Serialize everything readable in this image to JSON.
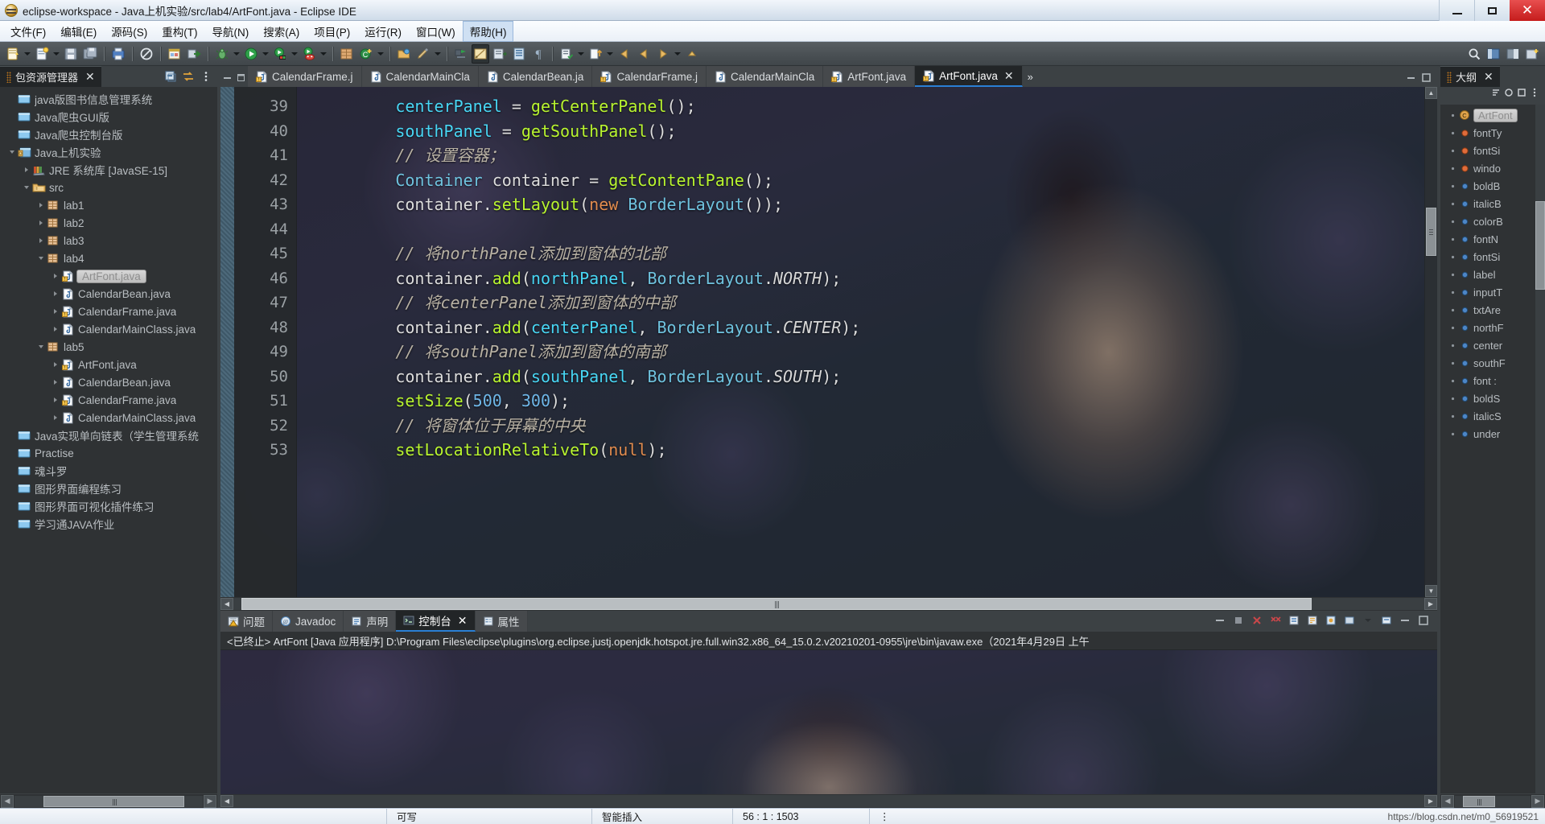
{
  "window": {
    "title": "eclipse-workspace - Java上机实验/src/lab4/ArtFont.java - Eclipse IDE",
    "app_icon": "eclipse-icon",
    "minimize_label": "最小化",
    "maximize_label": "最大化",
    "close_label": "关闭"
  },
  "menubar": {
    "items": [
      {
        "label": "文件(F)",
        "name": "menu-file"
      },
      {
        "label": "编辑(E)",
        "name": "menu-edit"
      },
      {
        "label": "源码(S)",
        "name": "menu-source"
      },
      {
        "label": "重构(T)",
        "name": "menu-refactor"
      },
      {
        "label": "导航(N)",
        "name": "menu-navigate"
      },
      {
        "label": "搜索(A)",
        "name": "menu-search"
      },
      {
        "label": "项目(P)",
        "name": "menu-project"
      },
      {
        "label": "运行(R)",
        "name": "menu-run"
      },
      {
        "label": "窗口(W)",
        "name": "menu-window"
      },
      {
        "label": "帮助(H)",
        "name": "menu-help"
      }
    ],
    "active_index": 9
  },
  "explorer": {
    "tab_title": "包资源管理器",
    "tab_close": "✕",
    "tree": [
      {
        "label": "java版图书信息管理系统",
        "depth": 0,
        "icon": "closed-project-folder-icon",
        "arrow": "none",
        "selected": false
      },
      {
        "label": "Java爬虫GUI版",
        "depth": 0,
        "icon": "closed-project-folder-icon",
        "arrow": "none",
        "selected": false
      },
      {
        "label": "Java爬虫控制台版",
        "depth": 0,
        "icon": "closed-project-folder-icon",
        "arrow": "none",
        "selected": false
      },
      {
        "label": "Java上机实验",
        "depth": 0,
        "icon": "java-project-icon",
        "arrow": "open",
        "selected": false
      },
      {
        "label": "JRE 系统库 [JavaSE-15]",
        "depth": 1,
        "icon": "jre-library-icon",
        "arrow": "closed",
        "selected": false
      },
      {
        "label": "src",
        "depth": 1,
        "icon": "source-folder-icon",
        "arrow": "open",
        "selected": false
      },
      {
        "label": "lab1",
        "depth": 2,
        "icon": "package-icon",
        "arrow": "closed",
        "selected": false
      },
      {
        "label": "lab2",
        "depth": 2,
        "icon": "package-icon",
        "arrow": "closed",
        "selected": false
      },
      {
        "label": "lab3",
        "depth": 2,
        "icon": "package-icon",
        "arrow": "closed",
        "selected": false
      },
      {
        "label": "lab4",
        "depth": 2,
        "icon": "package-icon",
        "arrow": "open",
        "selected": false
      },
      {
        "label": "ArtFont.java",
        "depth": 3,
        "icon": "java-class-warning-icon",
        "arrow": "closed",
        "selected": true
      },
      {
        "label": "CalendarBean.java",
        "depth": 3,
        "icon": "java-class-icon",
        "arrow": "closed",
        "selected": false
      },
      {
        "label": "CalendarFrame.java",
        "depth": 3,
        "icon": "java-class-warning-icon",
        "arrow": "closed",
        "selected": false
      },
      {
        "label": "CalendarMainClass.java",
        "depth": 3,
        "icon": "java-class-icon",
        "arrow": "closed",
        "selected": false
      },
      {
        "label": "lab5",
        "depth": 2,
        "icon": "package-icon",
        "arrow": "open",
        "selected": false
      },
      {
        "label": "ArtFont.java",
        "depth": 3,
        "icon": "java-class-warning-icon",
        "arrow": "closed",
        "selected": false
      },
      {
        "label": "CalendarBean.java",
        "depth": 3,
        "icon": "java-class-icon",
        "arrow": "closed",
        "selected": false
      },
      {
        "label": "CalendarFrame.java",
        "depth": 3,
        "icon": "java-class-warning-icon",
        "arrow": "closed",
        "selected": false
      },
      {
        "label": "CalendarMainClass.java",
        "depth": 3,
        "icon": "java-class-icon",
        "arrow": "closed",
        "selected": false
      },
      {
        "label": "Java实现单向链表（学生管理系统",
        "depth": 0,
        "icon": "closed-project-folder-icon",
        "arrow": "none",
        "selected": false
      },
      {
        "label": "Practise",
        "depth": 0,
        "icon": "closed-project-folder-icon",
        "arrow": "none",
        "selected": false
      },
      {
        "label": "魂斗罗",
        "depth": 0,
        "icon": "closed-project-folder-icon",
        "arrow": "none",
        "selected": false
      },
      {
        "label": "图形界面编程练习",
        "depth": 0,
        "icon": "closed-project-folder-icon",
        "arrow": "none",
        "selected": false
      },
      {
        "label": "图形界面可视化插件练习",
        "depth": 0,
        "icon": "closed-project-folder-icon",
        "arrow": "none",
        "selected": false
      },
      {
        "label": "学习通JAVA作业",
        "depth": 0,
        "icon": "closed-project-folder-icon",
        "arrow": "none",
        "selected": false
      }
    ]
  },
  "editor": {
    "tabs": [
      {
        "label": "CalendarFrame.j",
        "icon": "java-class-warning-icon",
        "active": false
      },
      {
        "label": "CalendarMainCla",
        "icon": "java-class-icon",
        "active": false
      },
      {
        "label": "CalendarBean.ja",
        "icon": "java-class-icon",
        "active": false
      },
      {
        "label": "CalendarFrame.j",
        "icon": "java-class-warning-icon",
        "active": false
      },
      {
        "label": "CalendarMainCla",
        "icon": "java-class-icon",
        "active": false
      },
      {
        "label": "ArtFont.java",
        "icon": "java-class-warning-icon",
        "active": false
      },
      {
        "label": "ArtFont.java",
        "icon": "java-class-warning-icon",
        "active": true,
        "close": "✕"
      }
    ],
    "overflow_label": "»",
    "lines": [
      {
        "n": 39,
        "tokens": [
          {
            "t": "        ",
            "c": "t-plain"
          },
          {
            "t": "centerPanel",
            "c": "t-field"
          },
          {
            "t": " = ",
            "c": "t-punc"
          },
          {
            "t": "getCenterPanel",
            "c": "t-method"
          },
          {
            "t": "();",
            "c": "t-punc"
          }
        ]
      },
      {
        "n": 40,
        "tokens": [
          {
            "t": "        ",
            "c": "t-plain"
          },
          {
            "t": "southPanel",
            "c": "t-field"
          },
          {
            "t": " = ",
            "c": "t-punc"
          },
          {
            "t": "getSouthPanel",
            "c": "t-method"
          },
          {
            "t": "();",
            "c": "t-punc"
          }
        ]
      },
      {
        "n": 41,
        "tokens": [
          {
            "t": "        ",
            "c": "t-plain"
          },
          {
            "t": "// 设置容器；",
            "c": "t-comment"
          }
        ]
      },
      {
        "n": 42,
        "tokens": [
          {
            "t": "        ",
            "c": "t-plain"
          },
          {
            "t": "Container",
            "c": "t-type"
          },
          {
            "t": " container = ",
            "c": "t-punc"
          },
          {
            "t": "getContentPane",
            "c": "t-method"
          },
          {
            "t": "();",
            "c": "t-punc"
          }
        ]
      },
      {
        "n": 43,
        "tokens": [
          {
            "t": "        container.",
            "c": "t-punc"
          },
          {
            "t": "setLayout",
            "c": "t-method"
          },
          {
            "t": "(",
            "c": "t-punc"
          },
          {
            "t": "new",
            "c": "t-kw"
          },
          {
            "t": " ",
            "c": "t-punc"
          },
          {
            "t": "BorderLayout",
            "c": "t-type"
          },
          {
            "t": "());",
            "c": "t-punc"
          }
        ]
      },
      {
        "n": 44,
        "tokens": [
          {
            "t": "",
            "c": "t-plain"
          }
        ]
      },
      {
        "n": 45,
        "tokens": [
          {
            "t": "        ",
            "c": "t-plain"
          },
          {
            "t": "// 将northPanel添加到窗体的北部",
            "c": "t-comment"
          }
        ]
      },
      {
        "n": 46,
        "tokens": [
          {
            "t": "        container.",
            "c": "t-punc"
          },
          {
            "t": "add",
            "c": "t-method"
          },
          {
            "t": "(",
            "c": "t-punc"
          },
          {
            "t": "northPanel",
            "c": "t-field"
          },
          {
            "t": ", ",
            "c": "t-punc"
          },
          {
            "t": "BorderLayout",
            "c": "t-type"
          },
          {
            "t": ".",
            "c": "t-punc"
          },
          {
            "t": "NORTH",
            "c": "t-const"
          },
          {
            "t": ");",
            "c": "t-punc"
          }
        ]
      },
      {
        "n": 47,
        "tokens": [
          {
            "t": "        ",
            "c": "t-plain"
          },
          {
            "t": "// 将centerPanel添加到窗体的中部",
            "c": "t-comment"
          }
        ]
      },
      {
        "n": 48,
        "tokens": [
          {
            "t": "        container.",
            "c": "t-punc"
          },
          {
            "t": "add",
            "c": "t-method"
          },
          {
            "t": "(",
            "c": "t-punc"
          },
          {
            "t": "centerPanel",
            "c": "t-field"
          },
          {
            "t": ", ",
            "c": "t-punc"
          },
          {
            "t": "BorderLayout",
            "c": "t-type"
          },
          {
            "t": ".",
            "c": "t-punc"
          },
          {
            "t": "CENTER",
            "c": "t-const"
          },
          {
            "t": ");",
            "c": "t-punc"
          }
        ]
      },
      {
        "n": 49,
        "tokens": [
          {
            "t": "        ",
            "c": "t-plain"
          },
          {
            "t": "// 将southPanel添加到窗体的南部",
            "c": "t-comment"
          }
        ]
      },
      {
        "n": 50,
        "tokens": [
          {
            "t": "        container.",
            "c": "t-punc"
          },
          {
            "t": "add",
            "c": "t-method"
          },
          {
            "t": "(",
            "c": "t-punc"
          },
          {
            "t": "southPanel",
            "c": "t-field"
          },
          {
            "t": ", ",
            "c": "t-punc"
          },
          {
            "t": "BorderLayout",
            "c": "t-type"
          },
          {
            "t": ".",
            "c": "t-punc"
          },
          {
            "t": "SOUTH",
            "c": "t-const"
          },
          {
            "t": ");",
            "c": "t-punc"
          }
        ]
      },
      {
        "n": 51,
        "tokens": [
          {
            "t": "        ",
            "c": "t-plain"
          },
          {
            "t": "setSize",
            "c": "t-method"
          },
          {
            "t": "(",
            "c": "t-punc"
          },
          {
            "t": "500",
            "c": "t-num"
          },
          {
            "t": ", ",
            "c": "t-punc"
          },
          {
            "t": "300",
            "c": "t-num"
          },
          {
            "t": ");",
            "c": "t-punc"
          }
        ]
      },
      {
        "n": 52,
        "tokens": [
          {
            "t": "        ",
            "c": "t-plain"
          },
          {
            "t": "// 将窗体位于屏幕的中央",
            "c": "t-comment"
          }
        ]
      },
      {
        "n": 53,
        "tokens": [
          {
            "t": "        ",
            "c": "t-plain"
          },
          {
            "t": "setLocationRelativeTo",
            "c": "t-method"
          },
          {
            "t": "(",
            "c": "t-punc"
          },
          {
            "t": "null",
            "c": "t-kw"
          },
          {
            "t": ");",
            "c": "t-punc"
          }
        ]
      }
    ]
  },
  "console": {
    "tabs": [
      {
        "label": "问题",
        "icon": "problems-icon",
        "active": false
      },
      {
        "label": "Javadoc",
        "icon": "javadoc-icon",
        "active": false
      },
      {
        "label": "声明",
        "icon": "declaration-icon",
        "active": false
      },
      {
        "label": "控制台",
        "icon": "console-icon",
        "active": true,
        "close": "✕"
      },
      {
        "label": "属性",
        "icon": "properties-icon",
        "active": false
      }
    ],
    "status_line": "<已终止> ArtFont [Java 应用程序] D:\\Program Files\\eclipse\\plugins\\org.eclipse.justj.openjdk.hotspot.jre.full.win32.x86_64_15.0.2.v20210201-0955\\jre\\bin\\javaw.exe（2021年4月29日 上午"
  },
  "outline": {
    "tab_title": "大纲",
    "tab_close": "✕",
    "items": [
      {
        "label": "ArtFont",
        "icon": "class-icon",
        "selected": true
      },
      {
        "label": "fontTy",
        "icon": "field-icon",
        "selected": false
      },
      {
        "label": "fontSi",
        "icon": "field-icon",
        "selected": false
      },
      {
        "label": "windo",
        "icon": "field-icon",
        "selected": false
      },
      {
        "label": "boldB",
        "icon": "field-blue-icon",
        "selected": false
      },
      {
        "label": "italicB",
        "icon": "field-blue-icon",
        "selected": false
      },
      {
        "label": "colorB",
        "icon": "field-blue-icon",
        "selected": false
      },
      {
        "label": "fontN",
        "icon": "field-blue-icon",
        "selected": false
      },
      {
        "label": "fontSi",
        "icon": "field-blue-icon",
        "selected": false
      },
      {
        "label": "label",
        "icon": "field-blue-icon",
        "selected": false
      },
      {
        "label": "inputT",
        "icon": "field-blue-icon",
        "selected": false
      },
      {
        "label": "txtAre",
        "icon": "field-blue-icon",
        "selected": false
      },
      {
        "label": "northF",
        "icon": "field-blue-icon",
        "selected": false
      },
      {
        "label": "center",
        "icon": "field-blue-icon",
        "selected": false
      },
      {
        "label": "southF",
        "icon": "field-blue-icon",
        "selected": false
      },
      {
        "label": "font :",
        "icon": "field-blue-icon",
        "selected": false
      },
      {
        "label": "boldS",
        "icon": "field-blue-icon",
        "selected": false
      },
      {
        "label": "italicS",
        "icon": "field-blue-icon",
        "selected": false
      },
      {
        "label": "under",
        "icon": "field-blue-icon",
        "selected": false
      }
    ]
  },
  "statusbar": {
    "writable_label": "可写",
    "insert_mode_label": "智能插入",
    "position_label": "56 : 1 : 1503",
    "watermark": "https://blog.csdn.net/m0_56919521"
  },
  "colors": {
    "accent": "#2a7fd4",
    "panel_bg": "#2f3234",
    "tab_active_bg": "#222527",
    "titlebar_close": "#c51c1c",
    "field_color": "#48d7f5",
    "method_color": "#b9f52f",
    "type_color": "#6fc3df",
    "keyword_color": "#e08b4e",
    "comment_color": "#b9b2a4",
    "number_color": "#6fb7e8"
  }
}
